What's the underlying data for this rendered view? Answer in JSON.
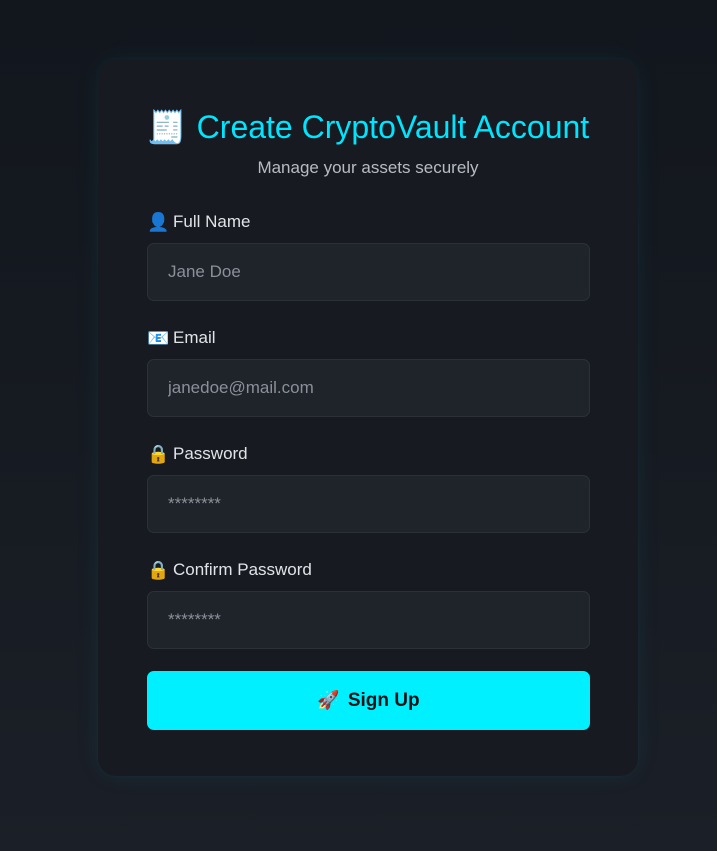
{
  "header": {
    "icon": "🧾",
    "icon_name": "receipt-icon",
    "title": "Create CryptoVault Account",
    "subtitle": "Manage your assets securely"
  },
  "form": {
    "fields": [
      {
        "icon": "👤",
        "icon_name": "user-icon",
        "label": "Full Name",
        "placeholder": "Jane Doe",
        "value": ""
      },
      {
        "icon": "📧",
        "icon_name": "email-icon",
        "label": "Email",
        "placeholder": "janedoe@mail.com",
        "value": ""
      },
      {
        "icon": "🔒",
        "icon_name": "lock-icon",
        "label": "Password",
        "placeholder": "********",
        "value": ""
      },
      {
        "icon": "🔒",
        "icon_name": "lock-icon",
        "label": "Confirm Password",
        "placeholder": "********",
        "value": ""
      }
    ],
    "submit": {
      "icon": "🚀",
      "icon_name": "rocket-icon",
      "label": "Sign Up"
    }
  },
  "colors": {
    "accent": "#00e5ff",
    "button": "#00f0ff",
    "card": "#171b21",
    "input_bg": "#1f232a",
    "background": "#14181f"
  }
}
